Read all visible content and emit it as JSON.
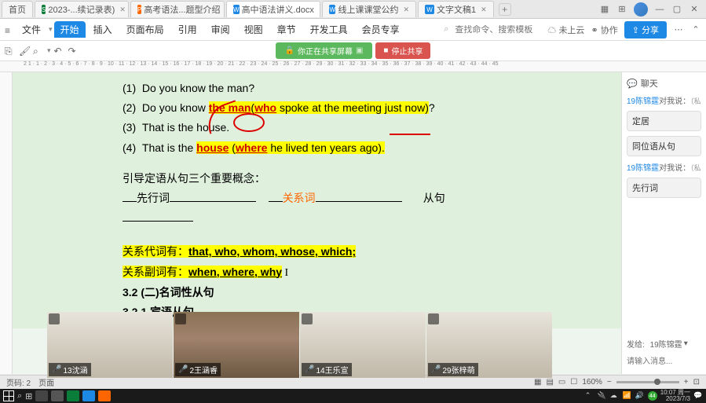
{
  "titlebar": {
    "tabs": [
      {
        "icon": "home",
        "label": "首页"
      },
      {
        "icon": "S",
        "label": "2023-...续记录表)"
      },
      {
        "icon": "P",
        "label": "高考语法...题型介绍"
      },
      {
        "icon": "W",
        "label": "高中语法讲义.docx",
        "active": true
      },
      {
        "icon": "W",
        "label": "线上课课堂公约"
      },
      {
        "icon": "W",
        "label": "文字文稿1"
      }
    ],
    "add": "+"
  },
  "menubar": {
    "items": [
      "文件",
      "开始",
      "插入",
      "页面布局",
      "引用",
      "审阅",
      "视图",
      "章节",
      "开发工具",
      "会员专享"
    ],
    "active_index": 1,
    "search_placeholder": "查找命令、搜索模板",
    "right": {
      "cloud": "未上云",
      "collab": "协作",
      "share": "分享"
    }
  },
  "sharing": {
    "sharing_text": "你正在共享屏幕",
    "stop_text": "停止共享"
  },
  "ruler_marks": "2  1  · 1 · 2 · 3 · 4 · 5 · 6 · 7 · 8 · 9 · 10 · 11 · 12 · 13 · 14 · 15 · 16 · 17 · 18 · 19 · 20 · 21 · 22 · 23 · 24 · 25 · 26 · 27 · 28 · 29 · 30 · 31 · 32 · 33 · 34 · 35 · 36 · 37 · 38 · 39 · 40 · 41 · 42 · 43 · 44 · 45",
  "doc": {
    "lines": [
      {
        "n": "(1)",
        "text": "Do you know the man?"
      },
      {
        "n": "(2)",
        "pre": "Do you know ",
        "hlred1": "the man",
        "paren_open": "(",
        "hlred2": "who",
        "rest": " spoke at the meeting just now)",
        "q": "?"
      },
      {
        "n": "(3)",
        "text": "That is the house."
      },
      {
        "n": "(4)",
        "pre": "That is the ",
        "hlred1": "house",
        "mid": " (",
        "hlred2": "where",
        "rest": " he lived ten years ago).",
        "q": ""
      }
    ],
    "concept_title": "引导定语从句三个重要概念：",
    "blank_labels": {
      "a": "先行词",
      "b": "关系词",
      "c": "从句"
    },
    "rel_pron_label": "关系代词有：",
    "rel_pron_list": "that, who, whom, whose, which; ",
    "rel_adv_label": "关系副词有：",
    "rel_adv_list": "when, where, why",
    "sec1": "3.2   (二)名词性从句",
    "sec2": "3.2.1   宾语从句"
  },
  "side": {
    "header": "聊天",
    "user": "19陈锦霆",
    "to_me": "对我说：",
    "recall": "（私",
    "msg1": "定居",
    "msg2": "同位语从句",
    "msg3": "先行词",
    "send_to": "发给:",
    "send_target": "19陈锦霆",
    "input_ph": "请输入消息..."
  },
  "videos": [
    {
      "name": "13沈涵"
    },
    {
      "name": "2王涵睿"
    },
    {
      "name": "14王乐宣"
    },
    {
      "name": "29张梓萌"
    }
  ],
  "status": {
    "page": "页码: 2",
    "pages": "页面",
    "zoom": "160%"
  },
  "taskbar": {
    "time": "10:07",
    "date": "2023/7/3",
    "day": "周一"
  }
}
